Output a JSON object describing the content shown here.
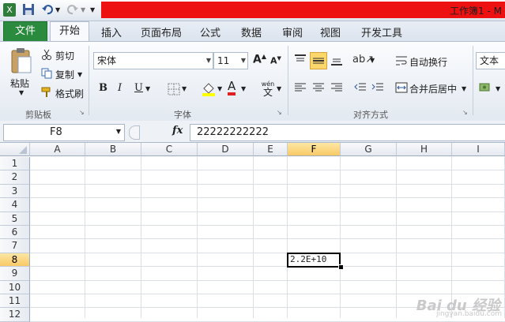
{
  "titlebar": {
    "title": "工作簿1 - M"
  },
  "tabs": {
    "file": "文件",
    "home": "开始",
    "insert": "插入",
    "layout": "页面布局",
    "formulas": "公式",
    "data": "数据",
    "review": "审阅",
    "view": "视图",
    "developer": "开发工具"
  },
  "ribbon": {
    "clipboard": {
      "paste": "粘贴",
      "cut": "剪切",
      "copy": "复制",
      "format_painter": "格式刷",
      "label": "剪贴板"
    },
    "font": {
      "font_name": "宋体",
      "font_size": "11",
      "bold": "B",
      "italic": "I",
      "underline": "U",
      "font_color": "A",
      "label": "字体",
      "grow": "A",
      "shrink": "A",
      "wen": "wén",
      "wen2": "文"
    },
    "alignment": {
      "wrap_text": "自动换行",
      "merge_center": "合并后居中",
      "label": "对齐方式"
    },
    "number": {
      "format": "文本"
    }
  },
  "formula_bar": {
    "name_box": "F8",
    "fx": "fx",
    "value": "22222222222"
  },
  "grid": {
    "columns": [
      "A",
      "B",
      "C",
      "D",
      "E",
      "F",
      "G",
      "H",
      "I"
    ],
    "rows": [
      "1",
      "2",
      "3",
      "4",
      "5",
      "6",
      "7",
      "8",
      "9",
      "10",
      "11",
      "12"
    ],
    "active_cell_value": "2.2E+10",
    "selected_column": "F",
    "selected_row": "8"
  },
  "watermark": {
    "brand": "Bai du 经验",
    "url": "jingyan.baidu.com"
  },
  "colors": {
    "file_tab": "#2a8a3e",
    "accent_bar": "#ee1111",
    "selection": "#f8c966"
  }
}
